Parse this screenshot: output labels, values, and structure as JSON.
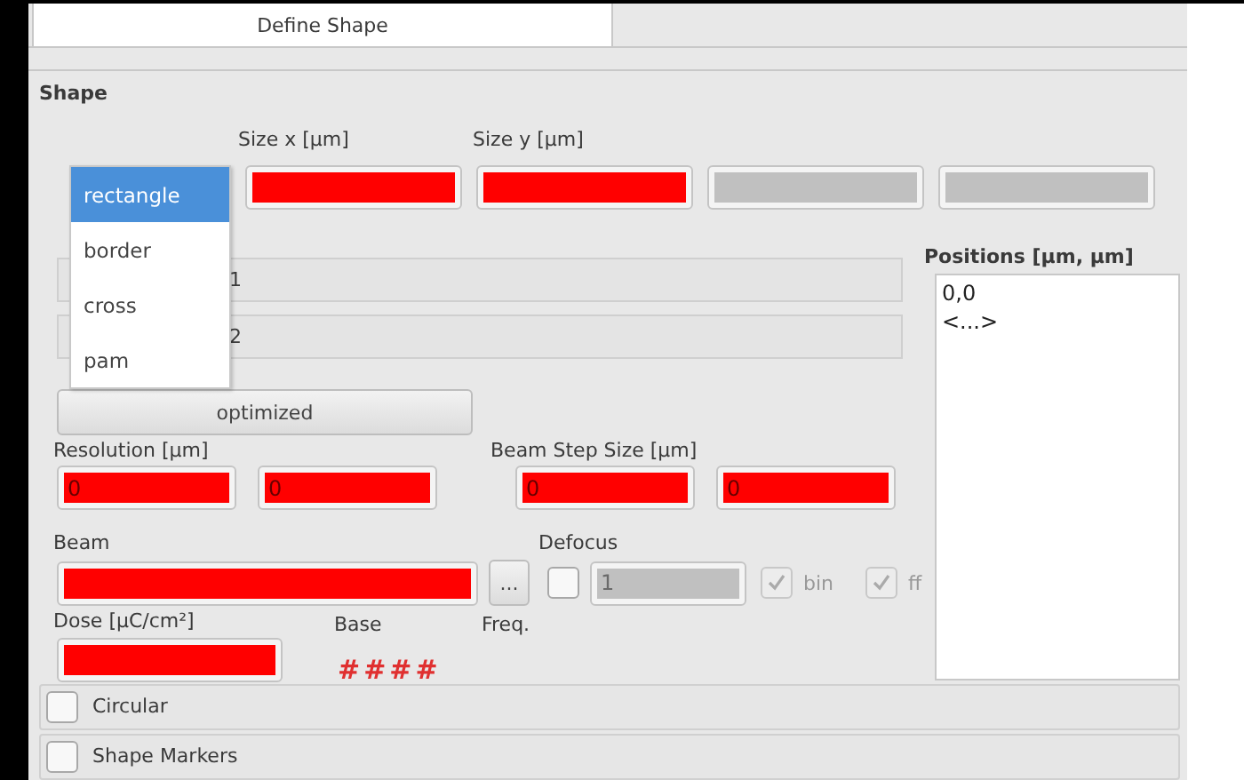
{
  "tabs": [
    {
      "label": "Define Shape",
      "selected": true
    }
  ],
  "shape": {
    "title": "Shape",
    "size_labels": [
      "Size x [µm]",
      "Size y [µm]"
    ],
    "shape_dropdown": {
      "expanded": true,
      "options": [
        {
          "label": "rectangle",
          "selected": true
        },
        {
          "label": "border",
          "selected": false
        },
        {
          "label": "cross",
          "selected": false
        },
        {
          "label": "pam",
          "selected": false
        }
      ]
    },
    "size_fields": [
      {
        "invalid": true,
        "disabled": false
      },
      {
        "invalid": true,
        "disabled": false
      },
      {
        "invalid": false,
        "disabled": true
      },
      {
        "invalid": false,
        "disabled": true
      }
    ],
    "lines": [
      {
        "value": "1"
      },
      {
        "value": "2"
      }
    ],
    "mode_button": "optimized",
    "resolution": {
      "label": "Resolution [µm]",
      "values": [
        "0",
        "0"
      ]
    },
    "beam_step": {
      "label": "Beam Step Size [µm]",
      "values": [
        "0",
        "0"
      ]
    },
    "beam": {
      "label": "Beam",
      "invalid": true,
      "browse_button": "..."
    },
    "defocus": {
      "label": "Defocus",
      "checked": false,
      "value": "1",
      "options": [
        {
          "label": "bin",
          "checked": true
        },
        {
          "label": "ff",
          "checked": true
        }
      ]
    },
    "dose": {
      "label": "Dose [µC/cm²]",
      "invalid": true
    },
    "base": {
      "label": "Base",
      "value": "####"
    },
    "freq": {
      "label": "Freq."
    },
    "positions": {
      "label": "Positions [µm, µm]",
      "items": [
        "0,0",
        "<...>"
      ]
    }
  },
  "sections": [
    {
      "label": "Circular",
      "checked": false
    },
    {
      "label": "Shape Markers",
      "checked": false
    }
  ]
}
